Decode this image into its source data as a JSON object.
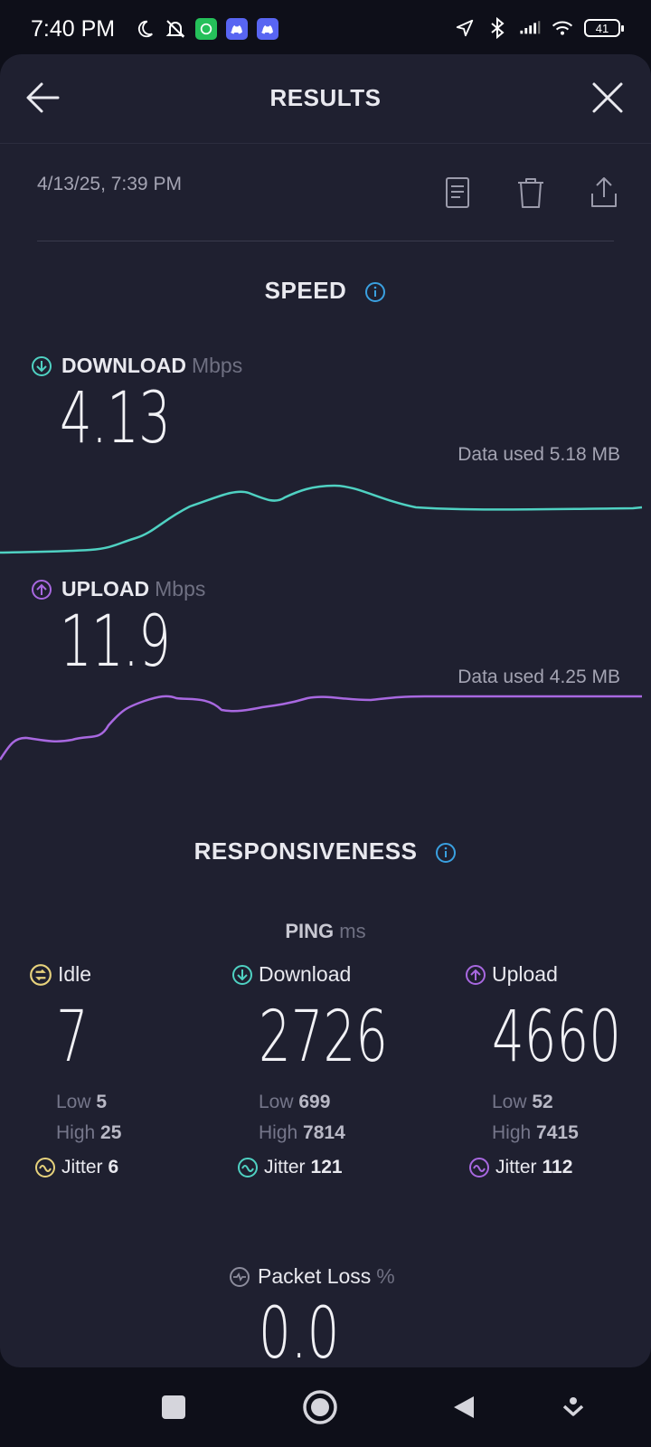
{
  "status_bar": {
    "time": "7:40 PM",
    "battery": "41",
    "icons": [
      "moon-icon",
      "mute-icon",
      "whatsapp-icon",
      "discord-icon",
      "discord-icon",
      "location-icon",
      "bluetooth-icon",
      "signal-icon",
      "wifi-icon",
      "battery-icon"
    ]
  },
  "header": {
    "title": "RESULTS"
  },
  "result": {
    "date": "4/13/25, 7:39 PM"
  },
  "speed": {
    "title": "SPEED",
    "download": {
      "label": "DOWNLOAD",
      "unit": "Mbps",
      "value": "4.13",
      "data_used": "Data used 5.18 MB",
      "color": "#4fd1c2"
    },
    "upload": {
      "label": "UPLOAD",
      "unit": "Mbps",
      "value": "11.9",
      "data_used": "Data used 4.25 MB",
      "color": "#a868e0"
    }
  },
  "responsiveness": {
    "title": "RESPONSIVENESS",
    "ping_label": "PING",
    "ping_unit": "ms",
    "idle": {
      "label": "Idle",
      "value": "7",
      "low_label": "Low",
      "low": "5",
      "high_label": "High",
      "high": "25",
      "jitter_label": "Jitter",
      "jitter": "6",
      "color": "#e7d27c"
    },
    "download": {
      "label": "Download",
      "value": "2726",
      "low_label": "Low",
      "low": "699",
      "high_label": "High",
      "high": "7814",
      "jitter_label": "Jitter",
      "jitter": "121",
      "color": "#4fd1c2"
    },
    "upload": {
      "label": "Upload",
      "value": "4660",
      "low_label": "Low",
      "low": "52",
      "high_label": "High",
      "high": "7415",
      "jitter_label": "Jitter",
      "jitter": "112",
      "color": "#a868e0"
    }
  },
  "packet_loss": {
    "label": "Packet Loss",
    "unit": "%",
    "value": "0.0"
  },
  "colors": {
    "accent_info": "#3aa0e0",
    "background": "#1f2030"
  }
}
